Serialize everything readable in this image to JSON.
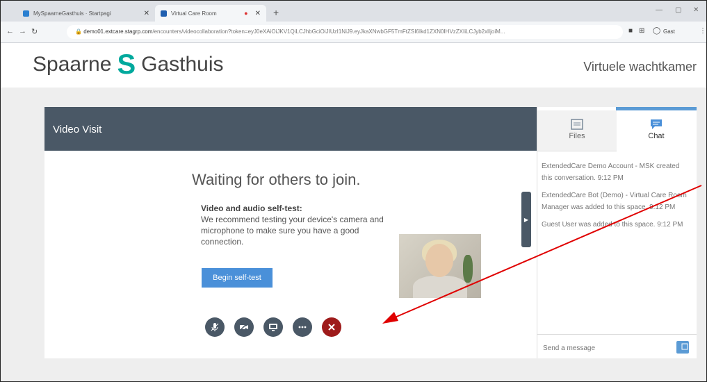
{
  "browser": {
    "tabs": [
      {
        "title": "MySpaarneGasthuis · Startpagi",
        "favicon_color": "#2a7fd0"
      },
      {
        "title": "Virtual Care Room",
        "favicon_color": "#1f5fb0"
      }
    ],
    "new_tab_label": "+",
    "url_host": "demo01.extcare.stagrp.com",
    "url_path": "/encounters/videocollaboration?token=eyJ0eXAiOiJKV1QiLCJhbGciOiJIUzI1NiJ9.eyJkaXNwbGF5TmFtZSI6Ikd1ZXN0IHVzZXIiLCJyb2xlIjoiM...",
    "profile_label": "Gast"
  },
  "site": {
    "brand_left": "Spaarne",
    "brand_mark": "S",
    "brand_right": "Gasthuis",
    "page_label": "Virtuele wachtkamer"
  },
  "visit": {
    "title": "Video Visit",
    "waiting_text": "Waiting for others to join.",
    "selftest_heading": "Video and audio self-test:",
    "selftest_body": "We recommend testing your device's camera and microphone to make sure you have a good connection.",
    "begin_button": "Begin self-test",
    "controls": [
      "microphone-icon",
      "camera-icon",
      "screen-share-icon",
      "more-icon",
      "end-call-icon"
    ]
  },
  "panel": {
    "tabs": {
      "files": "Files",
      "chat": "Chat"
    },
    "messages": [
      "ExtendedCare Demo Account - MSK created this conversation. 9:12 PM",
      "ExtendedCare Bot (Demo) - Virtual Care Room Manager was added to this space. 9:12 PM",
      "Guest User was added to this space. 9:12 PM"
    ],
    "input_placeholder": "Send a message"
  },
  "colors": {
    "header_bar": "#4a5866",
    "accent_blue": "#4a90d9",
    "end_call_red": "#9e1b1b",
    "brand_teal": "#00a99d",
    "annotation_red": "#e00000"
  }
}
